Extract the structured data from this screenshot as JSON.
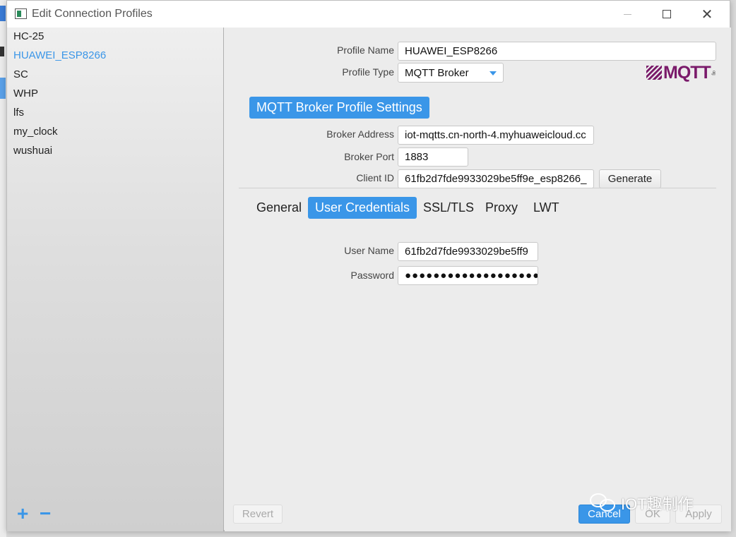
{
  "window": {
    "title": "Edit Connection Profiles",
    "close_glyph": "✕"
  },
  "sidebar": {
    "profiles": [
      {
        "label": "HC-25",
        "selected": false
      },
      {
        "label": "HUAWEI_ESP8266",
        "selected": true
      },
      {
        "label": "SC",
        "selected": false
      },
      {
        "label": "WHP",
        "selected": false
      },
      {
        "label": "lfs",
        "selected": false
      },
      {
        "label": "my_clock",
        "selected": false
      },
      {
        "label": "wushuai",
        "selected": false
      }
    ],
    "add_glyph": "+",
    "remove_glyph": "−"
  },
  "profile": {
    "name_label": "Profile Name",
    "name_value": "HUAWEI_ESP8266",
    "type_label": "Profile Type",
    "type_value": "MQTT Broker"
  },
  "logo": {
    "text": "MQTT",
    "sub": "org"
  },
  "broker": {
    "section_title": "MQTT Broker Profile Settings",
    "address_label": "Broker Address",
    "address_value": "iot-mqtts.cn-north-4.myhuaweicloud.cc",
    "port_label": "Broker Port",
    "port_value": "1883",
    "client_id_label": "Client ID",
    "client_id_value": "61fb2d7fde9933029be5ff9e_esp8266_",
    "generate_label": "Generate"
  },
  "tabs": [
    {
      "label": "General",
      "active": false
    },
    {
      "label": "User Credentials",
      "active": true
    },
    {
      "label": "SSL/TLS",
      "active": false
    },
    {
      "label": "Proxy",
      "active": false
    },
    {
      "label": "LWT",
      "active": false
    }
  ],
  "credentials": {
    "username_label": "User Name",
    "username_value": "61fb2d7fde9933029be5ff9",
    "password_label": "Password",
    "password_value": "●●●●●●●●●●●●●●●●●●●●"
  },
  "footer": {
    "revert_label": "Revert",
    "cancel_label": "Cancel",
    "ok_label": "OK",
    "apply_label": "Apply"
  },
  "watermark": {
    "text": "IOT趣制作"
  },
  "colors": {
    "accent": "#3a96e8",
    "mqtt_logo": "#7a1a6a"
  }
}
